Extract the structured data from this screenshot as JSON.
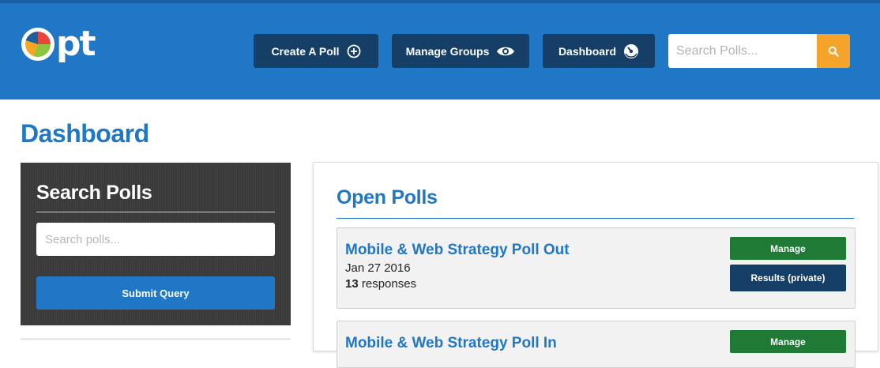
{
  "header": {
    "logo_text": "pt",
    "nav": {
      "create_label": "Create A Poll",
      "manage_groups_label": "Manage Groups",
      "dashboard_label": "Dashboard"
    },
    "search": {
      "placeholder": "Search Polls..."
    }
  },
  "page": {
    "title": "Dashboard"
  },
  "sidebar": {
    "title": "Search Polls",
    "search_placeholder": "Search polls...",
    "submit_label": "Submit Query"
  },
  "open_polls": {
    "title": "Open Polls",
    "items": [
      {
        "title": "Mobile & Web Strategy Poll Out",
        "date": "Jan 27 2016",
        "response_count": "13",
        "response_suffix": " responses",
        "manage_label": "Manage",
        "results_label": "Results (private)"
      },
      {
        "title": "Mobile & Web Strategy Poll In",
        "manage_label": "Manage"
      }
    ]
  },
  "colors": {
    "brand_blue": "#1f77c6",
    "dark_navy": "#153f67",
    "green": "#1f7a35",
    "search_orange": "#f4a42b"
  }
}
